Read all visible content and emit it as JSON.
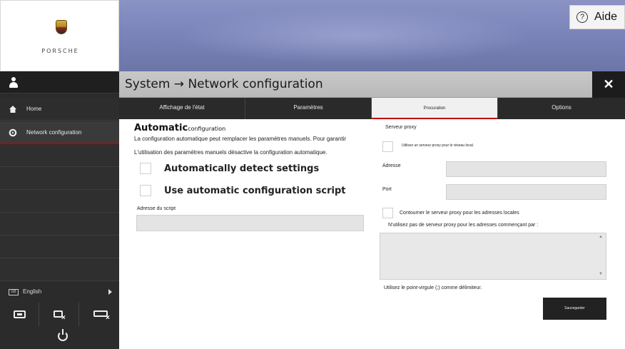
{
  "help": {
    "label": "Aide",
    "icon": "question-circle-icon"
  },
  "brand": {
    "logo_text": "PORSCHE"
  },
  "window": {
    "title": "System → Network configuration",
    "close_icon": "close-icon"
  },
  "sidebar": {
    "items": [
      {
        "label": "Home",
        "icon": "home-icon"
      },
      {
        "label": "Network configuration",
        "icon": "gear-icon"
      }
    ],
    "language": {
      "code": "GB",
      "label": "English"
    }
  },
  "tabs": [
    {
      "label": "Affichage de l'état"
    },
    {
      "label": "Paramètres"
    },
    {
      "label": "Procuration",
      "active": true
    },
    {
      "label": "Options"
    }
  ],
  "auto": {
    "heading": "Automatic",
    "heading_small": "configuration",
    "line1": "La configuration automatique peut remplacer les paramètres manuels. Pour garantir",
    "line2": "L'utilisation des paramètres manuels désactive la configuration automatique.",
    "detect_label": "Automatically detect settings",
    "script_label": "Use automatic configuration script",
    "script_address_label": "Adresse du script",
    "script_address_value": ""
  },
  "proxy": {
    "heading": "Serveur proxy",
    "use_proxy_label": "Utilisez un serveur proxy pour le réseau local.",
    "address_label": "Adresse",
    "address_value": "",
    "port_label": "Port",
    "port_value": "",
    "bypass_label": "Contourner le serveur proxy pour les adresses locales",
    "exceptions_label": "N'utilisez pas de serveur proxy pour les adresses commençant par :",
    "exceptions_value": "",
    "hint": "Utilisez le point-virgule (;) comme délimiteur.",
    "save_label": "Sauvegarder"
  },
  "colors": {
    "accent": "#c00000",
    "sidebar_bg": "#2b2b2b",
    "banner": "#7d86bb"
  }
}
